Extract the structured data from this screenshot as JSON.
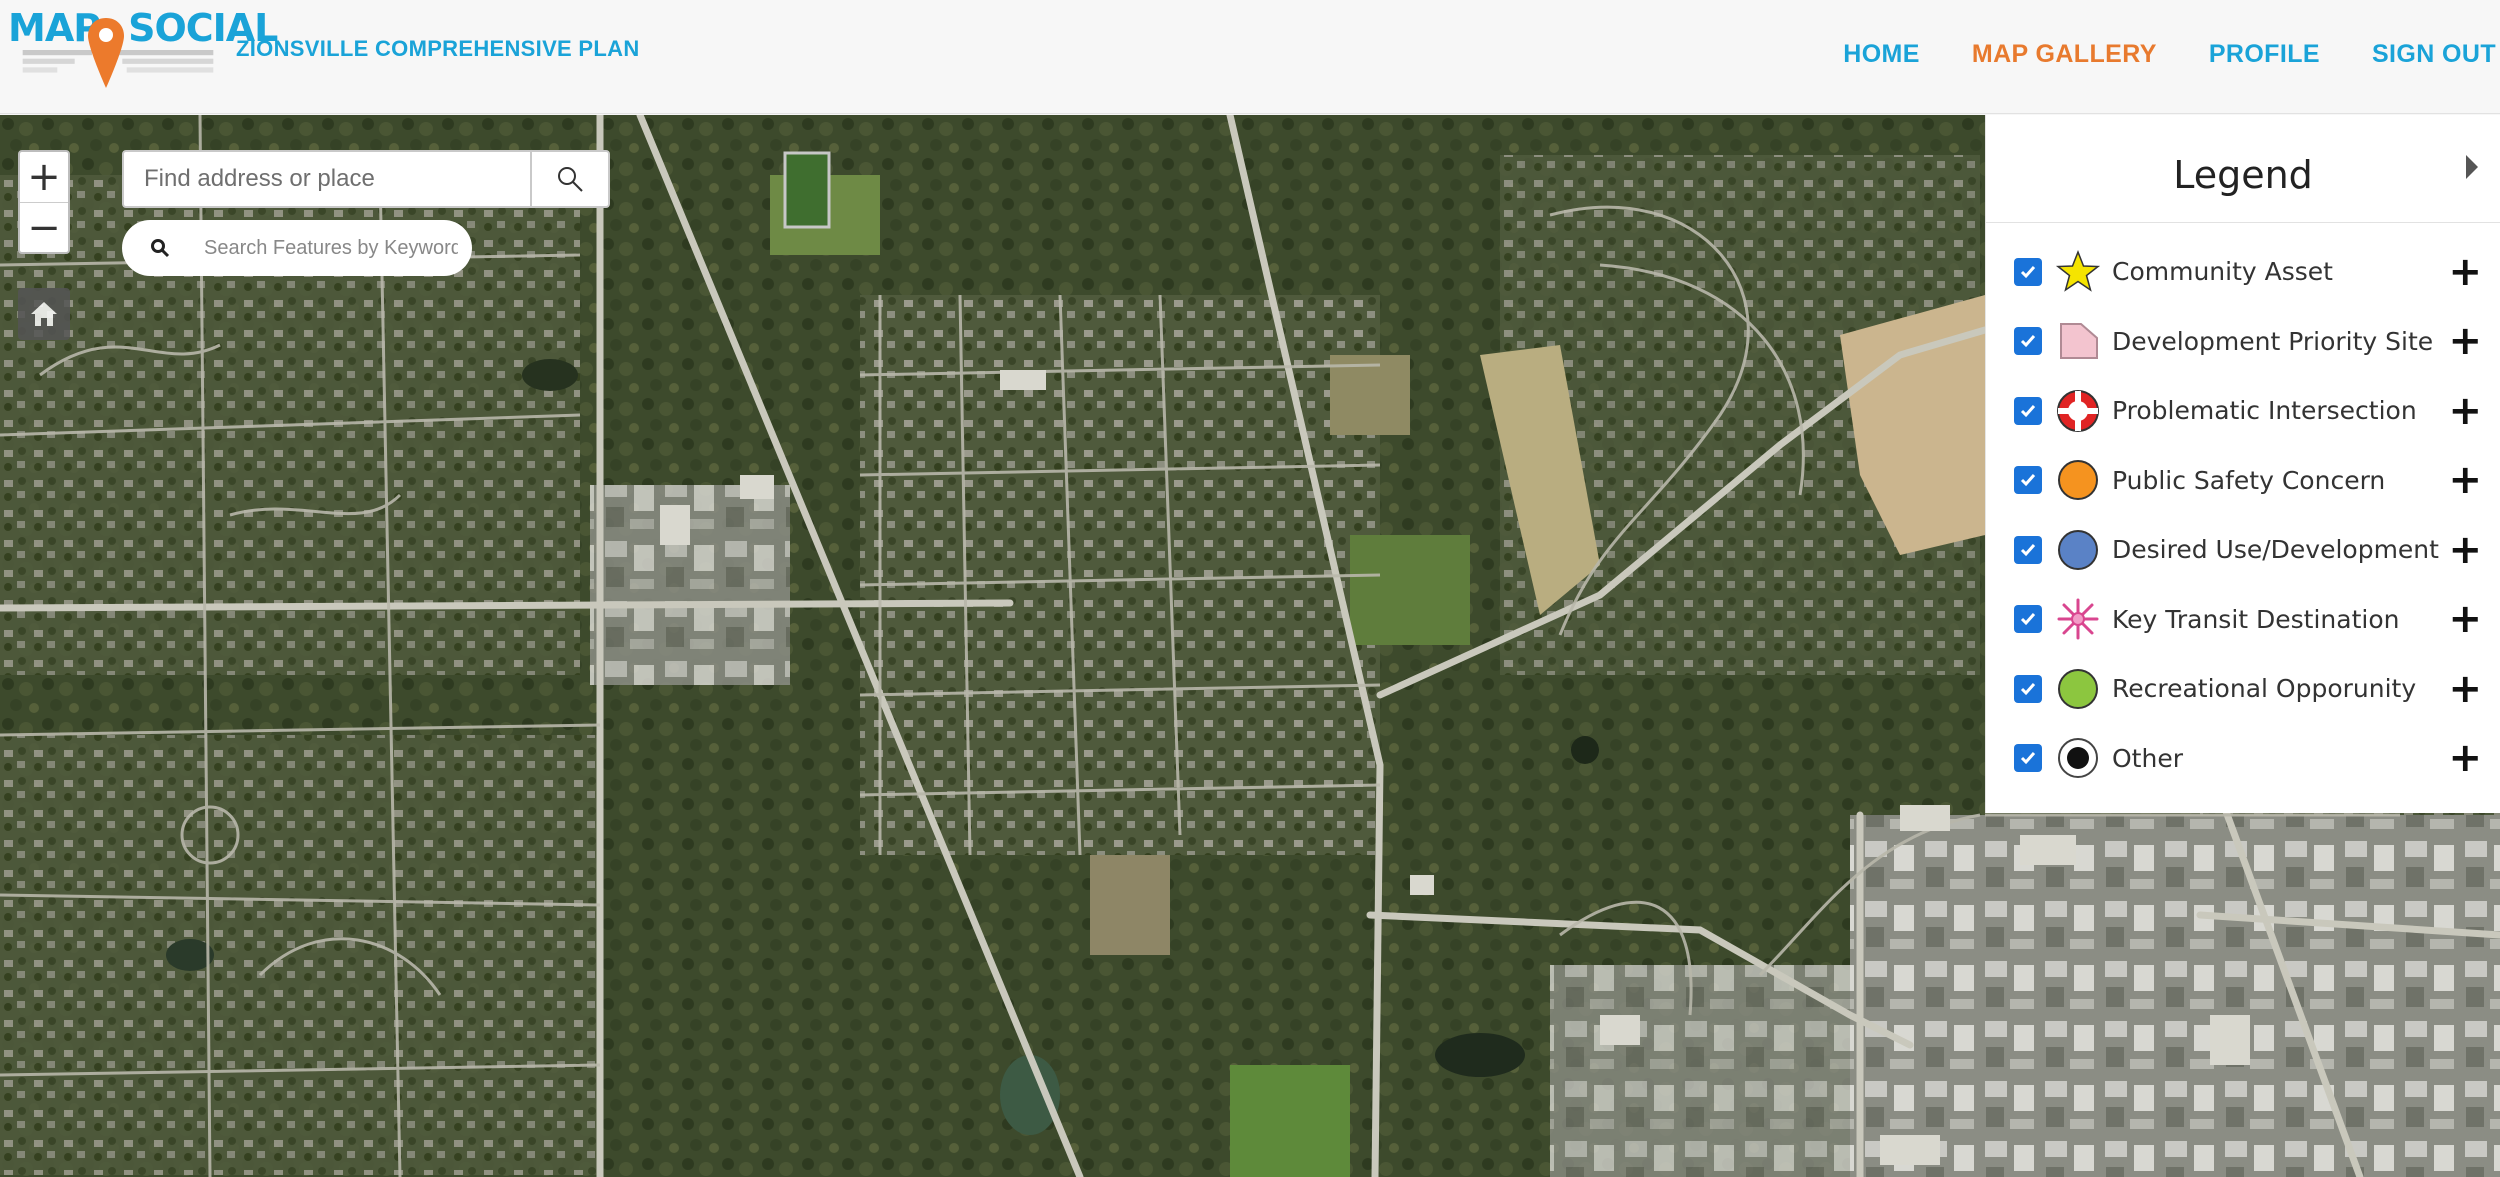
{
  "header": {
    "logo_text_left": "MAP",
    "logo_text_right": "SOCIAL",
    "title": "ZIONSVILLE COMPREHENSIVE PLAN",
    "nav": [
      {
        "label": "HOME",
        "active": false
      },
      {
        "label": "MAP GALLERY",
        "active": true
      },
      {
        "label": "PROFILE",
        "active": false
      },
      {
        "label": "SIGN OUT",
        "active": false
      }
    ],
    "accent_color": "#1aa3d8",
    "active_color": "#e87a2e"
  },
  "map": {
    "zoom_in": "+",
    "zoom_out": "−",
    "home_icon": "home-icon",
    "search": {
      "placeholder": "Find address or place",
      "button_icon": "search-icon"
    },
    "feature_search": {
      "placeholder": "Search Features by Keyword",
      "icon": "search-icon"
    }
  },
  "legend": {
    "title": "Legend",
    "items": [
      {
        "label": "Community Asset",
        "symbol": "star-icon",
        "checked": true
      },
      {
        "label": "Development Priority Site",
        "symbol": "pink-flag-icon",
        "checked": true
      },
      {
        "label": "Problematic Intersection",
        "symbol": "red-ring-icon",
        "checked": true
      },
      {
        "label": "Public Safety Concern",
        "symbol": "orange-circle-icon",
        "checked": true
      },
      {
        "label": "Desired Use/Development",
        "symbol": "blue-circle-icon",
        "checked": true
      },
      {
        "label": "Key Transit Destination",
        "symbol": "pink-burst-icon",
        "checked": true
      },
      {
        "label": "Recreational Opporunity",
        "symbol": "green-circle-icon",
        "checked": true
      },
      {
        "label": "Other",
        "symbol": "black-target-icon",
        "checked": true
      }
    ]
  }
}
